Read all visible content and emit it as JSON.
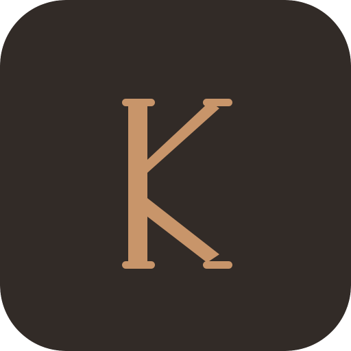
{
  "icon": {
    "name": "K",
    "monogram": "K",
    "colors": {
      "background": "#322b27",
      "letter": "#c8956a"
    },
    "icon_semantic": "letter-k-monogram-icon"
  }
}
